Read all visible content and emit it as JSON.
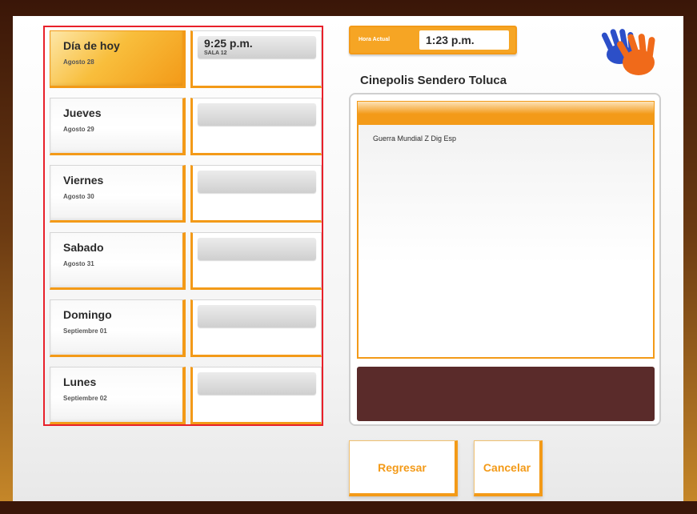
{
  "days": [
    {
      "name": "Día de hoy",
      "date": "Agosto 28",
      "active": true
    },
    {
      "name": "Jueves",
      "date": "Agosto 29",
      "active": false
    },
    {
      "name": "Viernes",
      "date": "Agosto 30",
      "active": false
    },
    {
      "name": "Sabado",
      "date": "Agosto 31",
      "active": false
    },
    {
      "name": "Domingo",
      "date": "Septiembre 01",
      "active": false
    },
    {
      "name": "Lunes",
      "date": "Septiembre 02",
      "active": false
    }
  ],
  "showtimes": [
    {
      "time": "9:25 p.m.",
      "room": "SALA 12"
    },
    {
      "time": "",
      "room": ""
    },
    {
      "time": "",
      "room": ""
    },
    {
      "time": "",
      "room": ""
    },
    {
      "time": "",
      "room": ""
    },
    {
      "time": "",
      "room": ""
    }
  ],
  "clock": {
    "label": "Hora Actual",
    "value": "1:23 p.m."
  },
  "cinema_name": "Cinepolis Sendero Toluca",
  "movies": [
    "Guerra Mundial Z Dig Esp"
  ],
  "buttons": {
    "back": "Regresar",
    "cancel": "Cancelar"
  },
  "colors": {
    "accent": "#f39a18",
    "selection_border": "#e8202a",
    "info_bar": "#5a2b2a"
  },
  "icons": {
    "logo": "waving-hands-icon"
  }
}
